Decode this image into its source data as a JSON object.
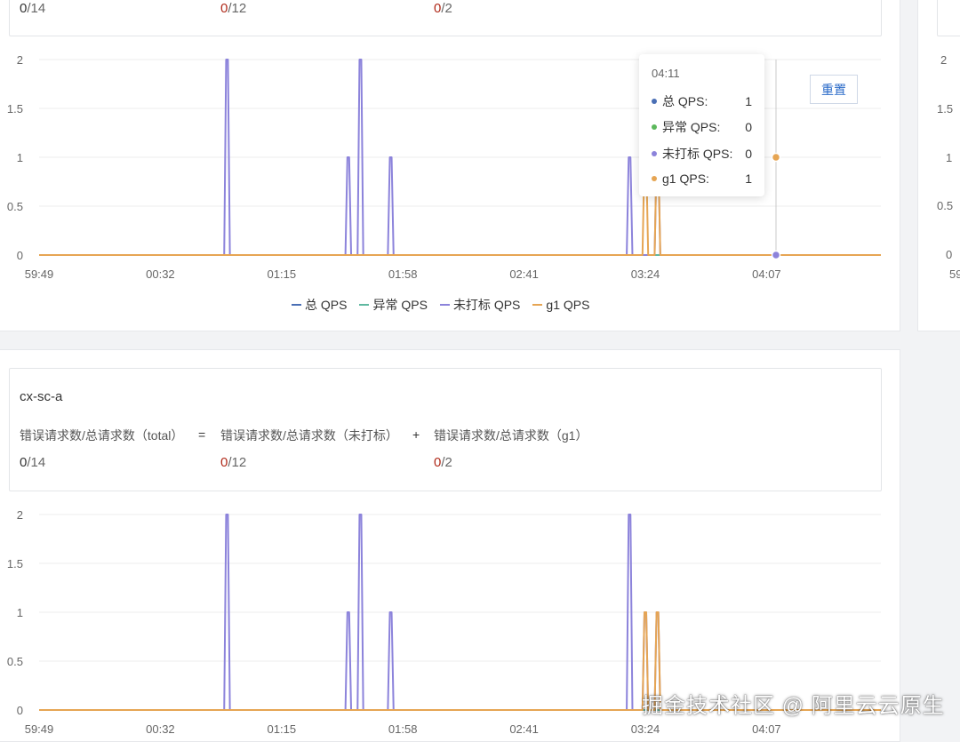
{
  "top_panel": {
    "stats": {
      "total": {
        "value": "0",
        "denom": "/14"
      },
      "untagged": {
        "value": "0",
        "denom": "/12"
      },
      "g1": {
        "value": "0",
        "denom": "/2"
      }
    },
    "reset_label": "重置",
    "tooltip": {
      "time": "04:11",
      "rows": [
        {
          "name": "总 QPS:",
          "value": "1",
          "color": "#4a6fb5"
        },
        {
          "name": "异常 QPS:",
          "value": "0",
          "color": "#5cb85c"
        },
        {
          "name": "未打标 QPS:",
          "value": "0",
          "color": "#8c83db"
        },
        {
          "name": "g1 QPS:",
          "value": "1",
          "color": "#e6a553"
        }
      ]
    },
    "legend": [
      {
        "label": "总 QPS",
        "color": "#4a6fb5"
      },
      {
        "label": "异常 QPS",
        "color": "#5fb8a0"
      },
      {
        "label": "未打标 QPS",
        "color": "#8c83db"
      },
      {
        "label": "g1 QPS",
        "color": "#e6a553"
      }
    ]
  },
  "bottom_panel": {
    "name": "cx-sc-a",
    "formula": {
      "total_label": "错误请求数/总请求数（total）",
      "equals": "=",
      "untagged_label": "错误请求数/总请求数（未打标）",
      "plus": "+",
      "g1_label": "错误请求数/总请求数（g1）"
    },
    "stats": {
      "total": {
        "value": "0",
        "denom": "/14"
      },
      "untagged": {
        "value": "0",
        "denom": "/12"
      },
      "g1": {
        "value": "0",
        "denom": "/2"
      }
    }
  },
  "right_partial": {
    "y_ticks": [
      "2",
      "1.5",
      "1",
      "0.5",
      "0"
    ],
    "x_tick": "59"
  },
  "watermark": "掘金技术社区 @ 阿里云云原生",
  "chart_data": [
    {
      "type": "line",
      "y_ticks": [
        "2",
        "1.5",
        "1",
        "0.5",
        "0"
      ],
      "ylim": [
        0,
        2
      ],
      "x_ticks": [
        "59:49",
        "00:32",
        "01:15",
        "01:58",
        "02:41",
        "03:24",
        "04:07"
      ],
      "series": [
        {
          "name": "总 QPS",
          "color": "#4a6fb5",
          "spikes": []
        },
        {
          "name": "异常 QPS",
          "color": "#5fb8a0",
          "spikes": []
        },
        {
          "name": "未打标 QPS",
          "color": "#8c83db",
          "spikes": [
            [
              1.55,
              2
            ],
            [
              2.55,
              1
            ],
            [
              2.65,
              2
            ],
            [
              2.9,
              1
            ],
            [
              4.87,
              1
            ],
            [
              5.1,
              1
            ]
          ]
        },
        {
          "name": "g1 QPS",
          "color": "#e6a553",
          "spikes": [
            [
              5.0,
              1
            ],
            [
              5.1,
              1
            ]
          ]
        }
      ]
    },
    {
      "type": "line",
      "y_ticks": [
        "2",
        "1.5",
        "1",
        "0.5",
        "0"
      ],
      "ylim": [
        0,
        2
      ],
      "x_ticks": [
        "59:49",
        "00:32",
        "01:15",
        "01:58",
        "02:41",
        "03:24",
        "04:07"
      ],
      "series": [
        {
          "name": "总 QPS",
          "color": "#4a6fb5",
          "spikes": []
        },
        {
          "name": "异常 QPS",
          "color": "#5fb8a0",
          "spikes": []
        },
        {
          "name": "未打标 QPS",
          "color": "#8c83db",
          "spikes": [
            [
              1.55,
              2
            ],
            [
              2.55,
              1
            ],
            [
              2.65,
              2
            ],
            [
              2.9,
              1
            ],
            [
              4.87,
              2
            ],
            [
              5.0,
              1
            ],
            [
              5.1,
              1
            ]
          ]
        },
        {
          "name": "g1 QPS",
          "color": "#e6a553",
          "spikes": [
            [
              5.0,
              1
            ],
            [
              5.1,
              1
            ]
          ]
        }
      ]
    }
  ]
}
